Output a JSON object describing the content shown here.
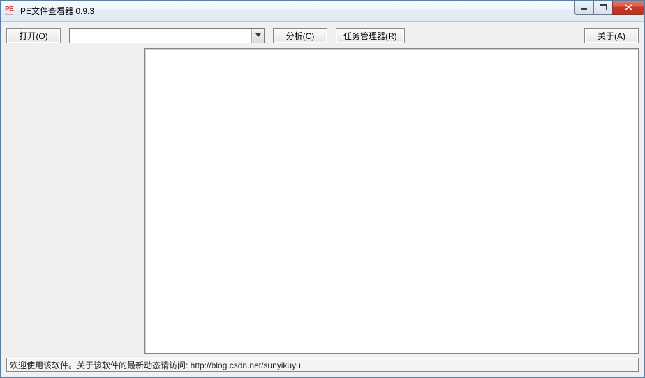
{
  "window": {
    "title": "PE文件查看器 0.9.3"
  },
  "toolbar": {
    "open_label": "打开(O)",
    "analyze_label": "分析(C)",
    "taskmgr_label": "任务管理器(R)",
    "about_label": "关于(A)",
    "file_value": ""
  },
  "statusbar": {
    "text": "欢迎使用该软件。关于该软件的最新动态请访问: http://blog.csdn.net/sunyikuyu"
  }
}
